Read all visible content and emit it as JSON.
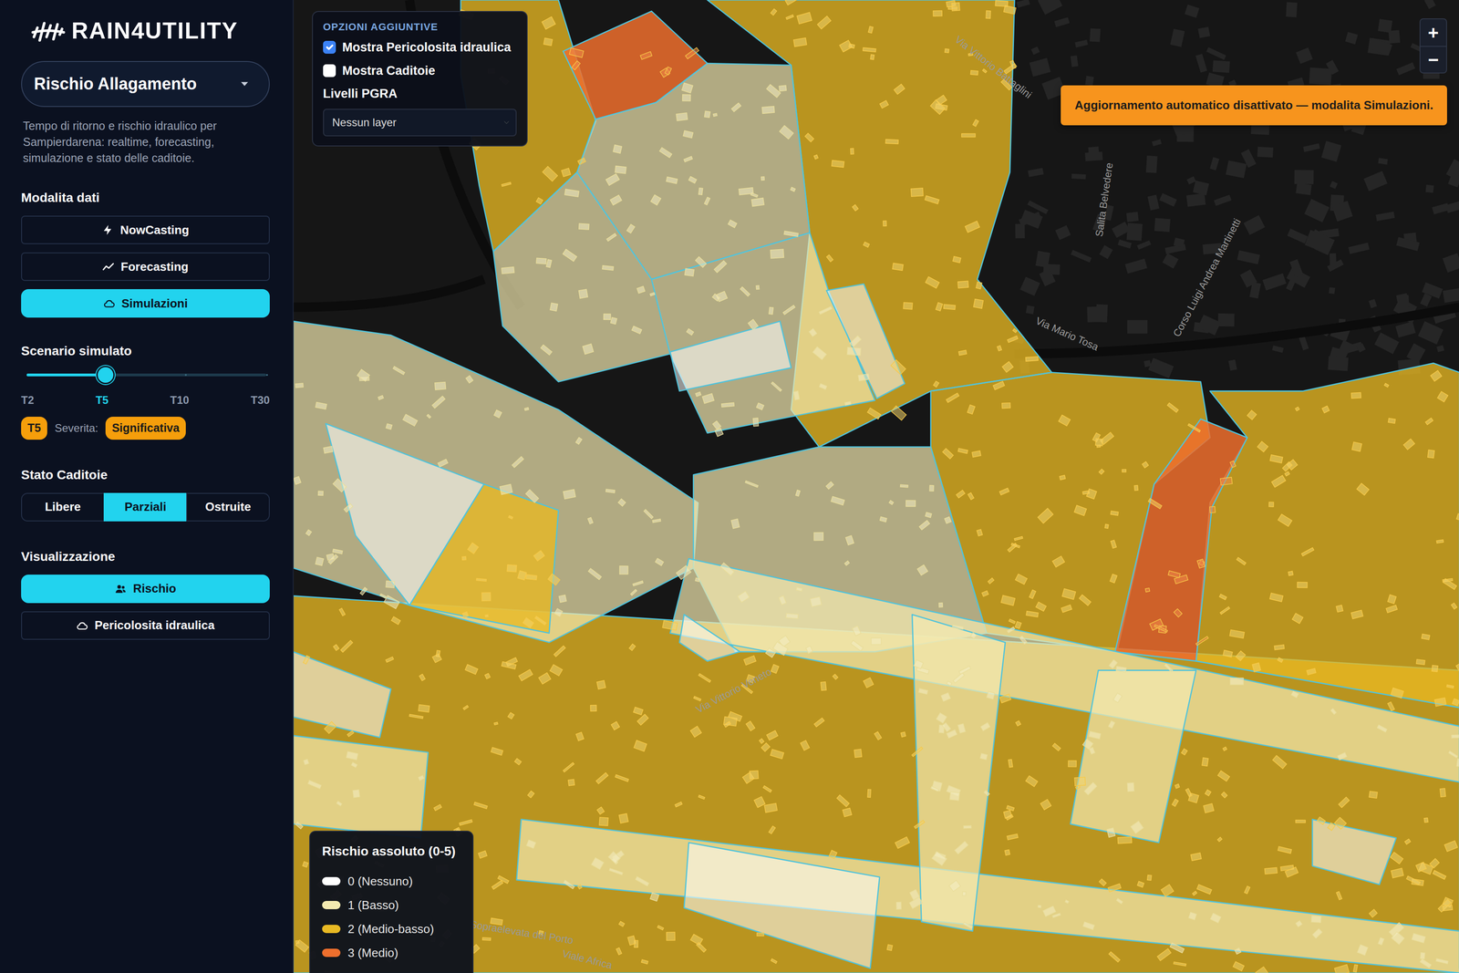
{
  "app": {
    "logo": "RAIN4UTILITY",
    "title": "Rischio Allagamento",
    "description": "Tempo di ritorno e rischio idraulico per Sampierdarena: realtime, forecasting, simulazione e stato delle caditoie."
  },
  "modes": {
    "heading": "Modalita dati",
    "items": [
      {
        "label": "NowCasting",
        "kind": "bolt",
        "selected": false
      },
      {
        "label": "Forecasting",
        "kind": "trend",
        "selected": false
      },
      {
        "label": "Simulazioni",
        "kind": "cloud",
        "selected": true
      }
    ]
  },
  "scenario": {
    "heading": "Scenario simulato",
    "level": 0.33,
    "ticks": [
      {
        "label": "T2",
        "selected": false
      },
      {
        "label": "T5",
        "selected": true
      },
      {
        "label": "T10",
        "selected": false
      },
      {
        "label": "T30",
        "selected": false
      }
    ],
    "badge": "T5",
    "severity_label": "Severita:",
    "severity": "Significativa"
  },
  "drains": {
    "heading": "Stato Caditoie",
    "items": [
      {
        "label": "Libere",
        "selected": false
      },
      {
        "label": "Parziali",
        "selected": true
      },
      {
        "label": "Ostruite",
        "selected": false
      }
    ]
  },
  "view": {
    "heading": "Visualizzazione",
    "items": [
      {
        "label": "Rischio",
        "kind": "people",
        "selected": true
      },
      {
        "label": "Pericolosita idraulica",
        "kind": "cloud",
        "selected": false
      }
    ]
  },
  "options": {
    "heading": "OPZIONI AGGIUNTIVE",
    "checks": [
      {
        "label": "Mostra Pericolosita idraulica",
        "checked": true
      },
      {
        "label": "Mostra Caditoie",
        "checked": false
      }
    ],
    "pgra_label": "Livelli PGRA",
    "pgra_value": "Nessun layer"
  },
  "zoom": [
    "+",
    "−"
  ],
  "toast": "Aggiornamento automatico disattivato — modalita Simulazioni.",
  "legend": {
    "title": "Rischio assoluto (0-5)",
    "items": [
      {
        "label": "0 (Nessuno)",
        "color": "#ffffff"
      },
      {
        "label": "1 (Basso)",
        "color": "#f3eab0"
      },
      {
        "label": "2 (Medio-basso)",
        "color": "#e8b923"
      },
      {
        "label": "3 (Medio)",
        "color": "#ee6f2d"
      }
    ]
  },
  "map": {
    "labels": [
      "Via Vittorio Veneto",
      "Via Mario Tosa",
      "Corso Luigi Andrea Martinetti",
      "Salita Belvedere",
      "Sopraelevata del Porto",
      "Viale Africa",
      "Via Vittorio Battaglini"
    ],
    "zones": [
      {
        "risk": 2
      },
      {
        "risk": 2
      },
      {
        "risk": 3
      },
      {
        "risk": 1
      },
      {
        "risk": 1
      },
      {
        "risk": 2
      },
      {
        "risk": 1
      },
      {
        "risk": 0
      },
      {
        "risk": 0
      },
      {
        "risk": 1
      },
      {
        "risk": 0
      },
      {
        "risk": 2
      },
      {
        "risk": 1
      },
      {
        "risk": 2
      },
      {
        "risk": 2
      },
      {
        "risk": 3
      },
      {
        "risk": 1
      },
      {
        "risk": 0
      },
      {
        "risk": 1
      },
      {
        "risk": 1
      },
      {
        "risk": 0
      },
      {
        "risk": 0
      },
      {
        "risk": 1
      },
      {
        "risk": 1
      },
      {
        "risk": 0
      }
    ]
  }
}
